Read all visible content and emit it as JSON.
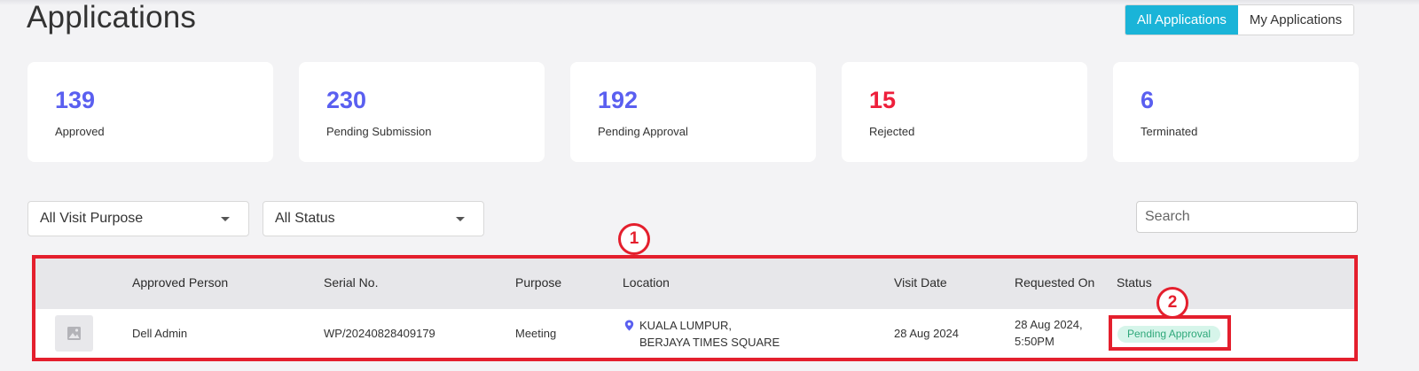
{
  "page_title": "Applications",
  "view_toggle": {
    "all_label": "All Applications",
    "mine_label": "My Applications"
  },
  "stats": [
    {
      "value": "139",
      "label": "Approved",
      "color": "#5a5ff0"
    },
    {
      "value": "230",
      "label": "Pending Submission",
      "color": "#5a5ff0"
    },
    {
      "value": "192",
      "label": "Pending Approval",
      "color": "#5a5ff0"
    },
    {
      "value": "15",
      "label": "Rejected",
      "color": "#ee1f3b"
    },
    {
      "value": "6",
      "label": "Terminated",
      "color": "#5a5ff0"
    }
  ],
  "filters": {
    "purpose_selected": "All Visit Purpose",
    "status_selected": "All Status",
    "search_placeholder": "Search"
  },
  "table": {
    "columns": [
      "Approved Person",
      "Serial No.",
      "Purpose",
      "Location",
      "Visit Date",
      "Requested On",
      "Status"
    ],
    "rows": [
      {
        "approved_person": "Dell Admin",
        "serial_no": "WP/20240828409179",
        "purpose": "Meeting",
        "location_line1": "KUALA LUMPUR,",
        "location_line2": "BERJAYA TIMES SQUARE",
        "visit_date": "28 Aug 2024",
        "requested_line1": "28 Aug 2024,",
        "requested_line2": "5:50PM",
        "status": "Pending Approval"
      }
    ]
  },
  "annotations": {
    "marker_1": "1",
    "marker_2": "2",
    "highlight_color": "#e41f2d"
  },
  "icons": {
    "row_thumbnail": "image-placeholder-icon",
    "location_pin": "map-pin-icon"
  }
}
